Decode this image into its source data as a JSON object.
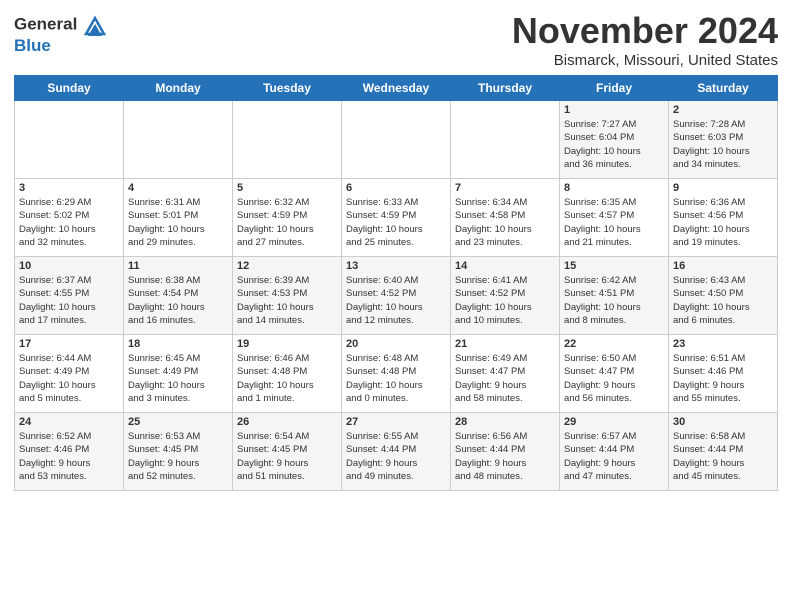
{
  "logo": {
    "line1": "General",
    "line2": "Blue"
  },
  "title": "November 2024",
  "location": "Bismarck, Missouri, United States",
  "weekdays": [
    "Sunday",
    "Monday",
    "Tuesday",
    "Wednesday",
    "Thursday",
    "Friday",
    "Saturday"
  ],
  "weeks": [
    [
      {
        "day": "",
        "info": ""
      },
      {
        "day": "",
        "info": ""
      },
      {
        "day": "",
        "info": ""
      },
      {
        "day": "",
        "info": ""
      },
      {
        "day": "",
        "info": ""
      },
      {
        "day": "1",
        "info": "Sunrise: 7:27 AM\nSunset: 6:04 PM\nDaylight: 10 hours\nand 36 minutes."
      },
      {
        "day": "2",
        "info": "Sunrise: 7:28 AM\nSunset: 6:03 PM\nDaylight: 10 hours\nand 34 minutes."
      }
    ],
    [
      {
        "day": "3",
        "info": "Sunrise: 6:29 AM\nSunset: 5:02 PM\nDaylight: 10 hours\nand 32 minutes."
      },
      {
        "day": "4",
        "info": "Sunrise: 6:31 AM\nSunset: 5:01 PM\nDaylight: 10 hours\nand 29 minutes."
      },
      {
        "day": "5",
        "info": "Sunrise: 6:32 AM\nSunset: 4:59 PM\nDaylight: 10 hours\nand 27 minutes."
      },
      {
        "day": "6",
        "info": "Sunrise: 6:33 AM\nSunset: 4:59 PM\nDaylight: 10 hours\nand 25 minutes."
      },
      {
        "day": "7",
        "info": "Sunrise: 6:34 AM\nSunset: 4:58 PM\nDaylight: 10 hours\nand 23 minutes."
      },
      {
        "day": "8",
        "info": "Sunrise: 6:35 AM\nSunset: 4:57 PM\nDaylight: 10 hours\nand 21 minutes."
      },
      {
        "day": "9",
        "info": "Sunrise: 6:36 AM\nSunset: 4:56 PM\nDaylight: 10 hours\nand 19 minutes."
      }
    ],
    [
      {
        "day": "10",
        "info": "Sunrise: 6:37 AM\nSunset: 4:55 PM\nDaylight: 10 hours\nand 17 minutes."
      },
      {
        "day": "11",
        "info": "Sunrise: 6:38 AM\nSunset: 4:54 PM\nDaylight: 10 hours\nand 16 minutes."
      },
      {
        "day": "12",
        "info": "Sunrise: 6:39 AM\nSunset: 4:53 PM\nDaylight: 10 hours\nand 14 minutes."
      },
      {
        "day": "13",
        "info": "Sunrise: 6:40 AM\nSunset: 4:52 PM\nDaylight: 10 hours\nand 12 minutes."
      },
      {
        "day": "14",
        "info": "Sunrise: 6:41 AM\nSunset: 4:52 PM\nDaylight: 10 hours\nand 10 minutes."
      },
      {
        "day": "15",
        "info": "Sunrise: 6:42 AM\nSunset: 4:51 PM\nDaylight: 10 hours\nand 8 minutes."
      },
      {
        "day": "16",
        "info": "Sunrise: 6:43 AM\nSunset: 4:50 PM\nDaylight: 10 hours\nand 6 minutes."
      }
    ],
    [
      {
        "day": "17",
        "info": "Sunrise: 6:44 AM\nSunset: 4:49 PM\nDaylight: 10 hours\nand 5 minutes."
      },
      {
        "day": "18",
        "info": "Sunrise: 6:45 AM\nSunset: 4:49 PM\nDaylight: 10 hours\nand 3 minutes."
      },
      {
        "day": "19",
        "info": "Sunrise: 6:46 AM\nSunset: 4:48 PM\nDaylight: 10 hours\nand 1 minute."
      },
      {
        "day": "20",
        "info": "Sunrise: 6:48 AM\nSunset: 4:48 PM\nDaylight: 10 hours\nand 0 minutes."
      },
      {
        "day": "21",
        "info": "Sunrise: 6:49 AM\nSunset: 4:47 PM\nDaylight: 9 hours\nand 58 minutes."
      },
      {
        "day": "22",
        "info": "Sunrise: 6:50 AM\nSunset: 4:47 PM\nDaylight: 9 hours\nand 56 minutes."
      },
      {
        "day": "23",
        "info": "Sunrise: 6:51 AM\nSunset: 4:46 PM\nDaylight: 9 hours\nand 55 minutes."
      }
    ],
    [
      {
        "day": "24",
        "info": "Sunrise: 6:52 AM\nSunset: 4:46 PM\nDaylight: 9 hours\nand 53 minutes."
      },
      {
        "day": "25",
        "info": "Sunrise: 6:53 AM\nSunset: 4:45 PM\nDaylight: 9 hours\nand 52 minutes."
      },
      {
        "day": "26",
        "info": "Sunrise: 6:54 AM\nSunset: 4:45 PM\nDaylight: 9 hours\nand 51 minutes."
      },
      {
        "day": "27",
        "info": "Sunrise: 6:55 AM\nSunset: 4:44 PM\nDaylight: 9 hours\nand 49 minutes."
      },
      {
        "day": "28",
        "info": "Sunrise: 6:56 AM\nSunset: 4:44 PM\nDaylight: 9 hours\nand 48 minutes."
      },
      {
        "day": "29",
        "info": "Sunrise: 6:57 AM\nSunset: 4:44 PM\nDaylight: 9 hours\nand 47 minutes."
      },
      {
        "day": "30",
        "info": "Sunrise: 6:58 AM\nSunset: 4:44 PM\nDaylight: 9 hours\nand 45 minutes."
      }
    ]
  ]
}
